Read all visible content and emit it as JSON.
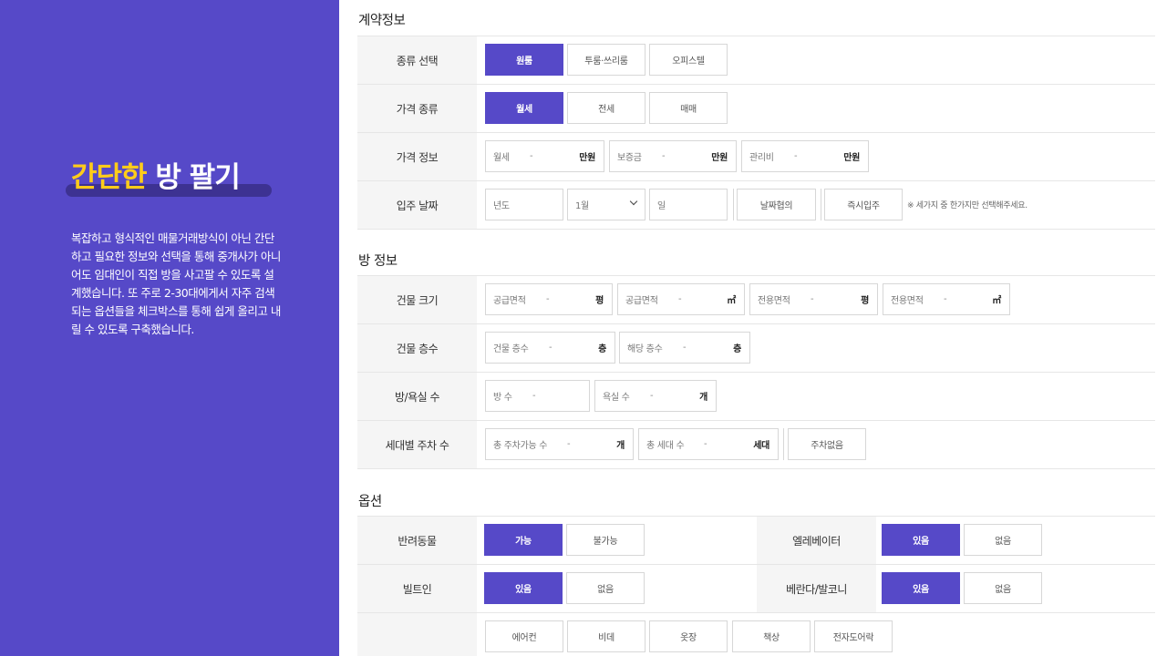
{
  "intro": {
    "title_highlight": "간단한",
    "title_rest": "방 팔기",
    "description": "복잡하고 형식적인 매물거래방식이 아닌 간단하고 필요한 정보와 선택을 통해 중개사가 아니어도 임대인이 직접 방을 사고팔 수 있도록 설계했습니다. 또 주로 2-30대에게서 자주 검색되는 옵션들을 체크박스를 통해 쉽게 올리고 내릴 수 있도록 구축했습니다."
  },
  "contract": {
    "title": "계약정보",
    "type": {
      "label": "종류 선택",
      "options": [
        "원룸",
        "투룸·쓰리룸",
        "오피스텔"
      ],
      "selected": "원룸"
    },
    "price_type": {
      "label": "가격 종류",
      "options": [
        "월세",
        "전세",
        "매매"
      ],
      "selected": "월세"
    },
    "price_info": {
      "label": "가격 정보",
      "fields": [
        {
          "placeholder": "월세",
          "dash": "-",
          "unit": "만원"
        },
        {
          "placeholder": "보증금",
          "dash": "-",
          "unit": "만원"
        },
        {
          "placeholder": "관리비",
          "dash": "-",
          "unit": "만원"
        }
      ]
    },
    "move_in": {
      "label": "입주 날짜",
      "year_placeholder": "년도",
      "month_value": "1월",
      "day_placeholder": "일",
      "negotiable": "날짜협의",
      "immediate": "즉시입주",
      "note": "※ 세가지 중 한가지만 선택해주세요."
    }
  },
  "room": {
    "title": "방 정보",
    "size": {
      "label": "건물 크기",
      "fields": [
        {
          "placeholder": "공급면적",
          "dash": "-",
          "unit": "평"
        },
        {
          "placeholder": "공급면적",
          "dash": "-",
          "unit": "㎡"
        },
        {
          "placeholder": "전용면적",
          "dash": "-",
          "unit": "평"
        },
        {
          "placeholder": "전용면적",
          "dash": "-",
          "unit": "㎡"
        }
      ]
    },
    "floors": {
      "label": "건물 층수",
      "fields": [
        {
          "placeholder": "건물 층수",
          "dash": "-",
          "unit": "층"
        },
        {
          "placeholder": "해당 층수",
          "dash": "-",
          "unit": "층"
        }
      ]
    },
    "rooms": {
      "label": "방/욕실 수",
      "fields": [
        {
          "placeholder": "방 수",
          "dash": "-",
          "unit": ""
        },
        {
          "placeholder": "욕실 수",
          "dash": "-",
          "unit": "개"
        }
      ]
    },
    "parking": {
      "label": "세대별 주차 수",
      "fields": [
        {
          "placeholder": "총 주차가능 수",
          "dash": "-",
          "unit": "개"
        },
        {
          "placeholder": "총 세대 수",
          "dash": "-",
          "unit": "세대"
        }
      ],
      "none_button": "주차없음"
    }
  },
  "options": {
    "title": "옵션",
    "pets": {
      "label": "반려동물",
      "options": [
        "가능",
        "불가능"
      ],
      "selected": "가능"
    },
    "elevator": {
      "label": "엘레베이터",
      "options": [
        "있음",
        "없음"
      ],
      "selected": "있음"
    },
    "builtin": {
      "label": "빌트인",
      "options": [
        "있음",
        "없음"
      ],
      "selected": "있음"
    },
    "balcony": {
      "label": "베란다/발코니",
      "options": [
        "있음",
        "없음"
      ],
      "selected": "있음"
    },
    "items": [
      "에어컨",
      "비데",
      "옷장",
      "책상",
      "전자도어락"
    ]
  },
  "colors": {
    "accent": "#5649c8",
    "highlight": "#ffcc1a",
    "label_bg": "#f5f5f5"
  }
}
